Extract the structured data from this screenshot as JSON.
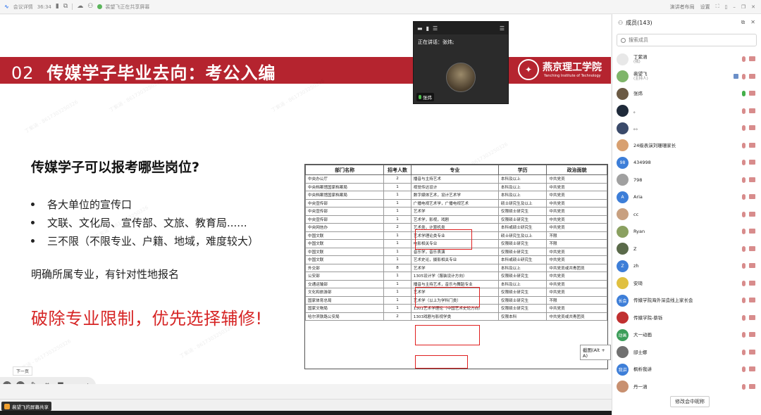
{
  "topbar": {
    "meeting_details": "会议详情",
    "timer": "36:34",
    "sharing_status": "裴望飞正在共享屏幕"
  },
  "topright": {
    "layout_label": "演讲者布局",
    "settings_label": "设置"
  },
  "slide": {
    "section_number": "02",
    "section_title": "传媒学子毕业去向：考公入编",
    "university_name": "燕京理工学院",
    "university_en": "Yanching Institute of Technology",
    "question": "传媒学子可以报考哪些岗位?",
    "bullets": [
      "各大单位的宣传口",
      "文联、文化局、宣传部、文旅、教育局......",
      "三不限（不限专业、户籍、地域，难度较大）"
    ],
    "advice": "明确所属专业，有针对性地报名",
    "slogan": "破除专业限制，优先选择辅修!",
    "watermark": "丁紫涵 - 8617303250326"
  },
  "job_table": {
    "headers": [
      "部门名称",
      "招考人数",
      "专业",
      "学历",
      "政治面貌"
    ],
    "rows": [
      [
        "中央办公厅",
        "2",
        "播音与主持艺术",
        "本科及以上",
        "中共党员"
      ],
      [
        "中央档案馆国家档案局",
        "1",
        "视觉传达设计",
        "本科及以上",
        "中共党员"
      ],
      [
        "中央档案馆国家档案局",
        "1",
        "数字媒体艺术，设计艺术学",
        "本科及以上",
        "中共党员"
      ],
      [
        "中央宣传部",
        "1",
        "广播电视艺术学，广播电视艺术",
        "硕士研究生及以上",
        "中共党员"
      ],
      [
        "中央宣传部",
        "1",
        "艺术学",
        "仅限硕士研究生",
        "中共党员"
      ],
      [
        "中央宣传部",
        "1",
        "艺术学，影视，戏剧",
        "仅限硕士研究生",
        "中共党员"
      ],
      [
        "中央网信办",
        "2",
        "艺术类，计算机类",
        "本科或硕士研究生",
        "中共党员"
      ],
      [
        "中国文联",
        "1",
        "艺术学理论类专业",
        "硕士研究生及以上",
        "不限"
      ],
      [
        "中国文联",
        "1",
        "电影相关专业",
        "仅限硕士研究生",
        "不限"
      ],
      [
        "中国文联",
        "1",
        "音乐学，音乐表演",
        "仅限硕士研究生",
        "中共党员"
      ],
      [
        "中国文联",
        "1",
        "艺术史论，摄影相关专业",
        "本科或硕士研究生",
        "中共党员"
      ],
      [
        "外交部",
        "8",
        "艺术学",
        "本科及以上",
        "中共党员或共青团员"
      ],
      [
        "公安部",
        "1",
        "1305设计学（服装设计方向）",
        "仅限硕士研究生",
        "中共党员"
      ],
      [
        "交通运输部",
        "1",
        "播音与主持艺术，音乐与舞蹈专业",
        "本科及以上",
        "中共党员"
      ],
      [
        "文化和旅游部",
        "1",
        "艺术学",
        "仅限硕士研究生",
        "中共党员"
      ],
      [
        "国家体育总局",
        "1",
        "艺术学（以上为学科门类）",
        "仅限硕士研究生",
        "不限"
      ],
      [
        "国家文物局",
        "1",
        "1301艺术学理论（中国艺术史论方向）",
        "仅限硕士研究生",
        "中共党员"
      ],
      [
        "哈尔滨铁路公安局",
        "2",
        "1303戏剧与影视学类",
        "仅限本科",
        "中共党员或共青团员"
      ]
    ],
    "screenshot_tooltip": "截图(Alt + A)"
  },
  "speaker_panel": {
    "now_speaking": "正在讲话：张炜;",
    "speaker_name": "张炜"
  },
  "slide_toolbar": {
    "next_tip": "下一页"
  },
  "bottom": {
    "share_label": "裴望飞的屏幕共享"
  },
  "members": {
    "title": "成员(143)",
    "search_placeholder": "搜索成员",
    "rename_button": "修改会中昵称",
    "list": [
      {
        "name": "丁紫涵",
        "sub": "(我)",
        "avatar_text": "",
        "avatar_color": "#e8e8e8"
      },
      {
        "name": "裴望飞",
        "sub": "(主持人)",
        "avatar_text": "",
        "avatar_color": "#7fb56a"
      },
      {
        "name": "张炜",
        "sub": "",
        "avatar_text": "",
        "avatar_color": "#6b5a44"
      },
      {
        "name": "。",
        "sub": "",
        "avatar_text": "",
        "avatar_color": "#1f2a3a"
      },
      {
        "name": "。。",
        "sub": "",
        "avatar_text": "",
        "avatar_color": "#3a4a6a"
      },
      {
        "name": "24级表演刘珊珊家长",
        "sub": "",
        "avatar_text": "",
        "avatar_color": "#d8a070"
      },
      {
        "name": "434998",
        "sub": "",
        "avatar_text": "98",
        "avatar_color": "#3d7ed8"
      },
      {
        "name": "798",
        "sub": "",
        "avatar_text": "",
        "avatar_color": "#a0a0a0"
      },
      {
        "name": "Aria",
        "sub": "",
        "avatar_text": "A",
        "avatar_color": "#3d7ed8"
      },
      {
        "name": "cc",
        "sub": "",
        "avatar_text": "",
        "avatar_color": "#c8a080"
      },
      {
        "name": "Ryan",
        "sub": "",
        "avatar_text": "",
        "avatar_color": "#8aa060"
      },
      {
        "name": "Z",
        "sub": "",
        "avatar_text": "",
        "avatar_color": "#5a6a4a"
      },
      {
        "name": "zh",
        "sub": "",
        "avatar_text": "Z",
        "avatar_color": "#3d7ed8"
      },
      {
        "name": "安琦",
        "sub": "",
        "avatar_text": "",
        "avatar_color": "#e0c040"
      },
      {
        "name": "传媒学院海外深造线上家长会",
        "sub": "",
        "avatar_text": "长会",
        "avatar_color": "#3d7ed8"
      },
      {
        "name": "传媒学院-蔡铄",
        "sub": "",
        "avatar_text": "",
        "avatar_color": "#c03030"
      },
      {
        "name": "大一动画",
        "sub": "",
        "avatar_text": "动画",
        "avatar_color": "#3d9e5a"
      },
      {
        "name": "邸士娜",
        "sub": "",
        "avatar_text": "",
        "avatar_color": "#707070"
      },
      {
        "name": "枫析我讲",
        "sub": "",
        "avatar_text": "我讲",
        "avatar_color": "#3d7ed8"
      },
      {
        "name": "丹一涵",
        "sub": "",
        "avatar_text": "",
        "avatar_color": "#c89070"
      }
    ]
  }
}
